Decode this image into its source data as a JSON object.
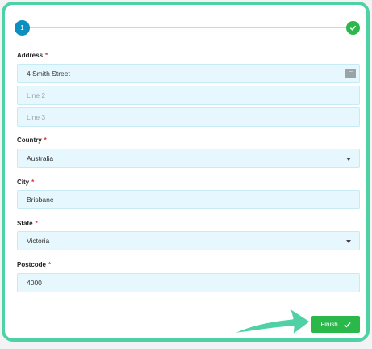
{
  "stepper": {
    "step_number": "1",
    "completed_icon": "check-circle-icon"
  },
  "form": {
    "address": {
      "label": "Address",
      "required_mark": "*",
      "line1_value": "4 Smith Street",
      "line2_placeholder": "Line 2",
      "line3_placeholder": "Line 3"
    },
    "country": {
      "label": "Country",
      "required_mark": "*",
      "selected": "Australia"
    },
    "city": {
      "label": "City",
      "required_mark": "*",
      "value": "Brisbane"
    },
    "state": {
      "label": "State",
      "required_mark": "*",
      "selected": "Victoria"
    },
    "postcode": {
      "label": "Postcode",
      "required_mark": "*",
      "value": "4000"
    }
  },
  "actions": {
    "finish_label": "Finish"
  },
  "colors": {
    "highlight": "#4fd1a5",
    "success": "#2bb84a",
    "step_active": "#0b8fbf",
    "field_bg": "#e6f8fd",
    "required": "#e0312f"
  }
}
